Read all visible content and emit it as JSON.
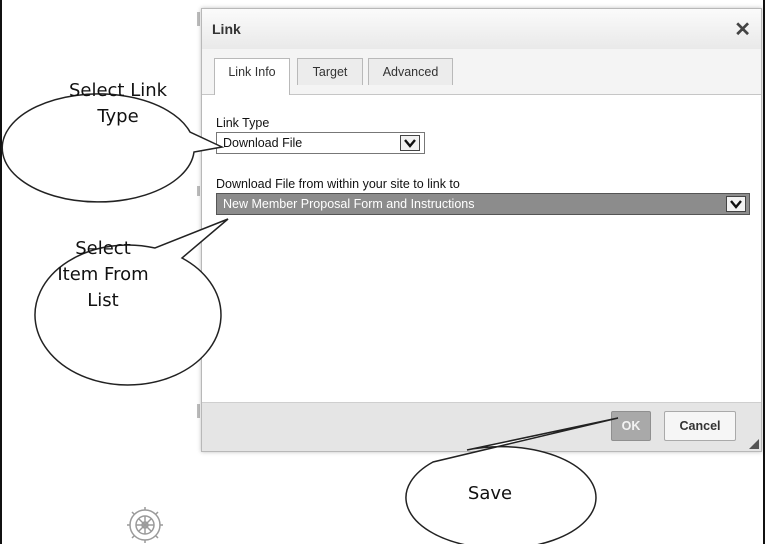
{
  "dialog": {
    "title": "Link",
    "close_icon": "close-icon",
    "tabs": [
      {
        "label": "Link Info",
        "active": true
      },
      {
        "label": "Target",
        "active": false
      },
      {
        "label": "Advanced",
        "active": false
      }
    ],
    "link_type": {
      "label": "Link Type",
      "selected": "Download File"
    },
    "download_file": {
      "label": "Download File from within your site to link to",
      "selected": "New Member Proposal Form and Instructions"
    },
    "buttons": {
      "ok": "OK",
      "cancel": "Cancel"
    }
  },
  "callouts": {
    "link_type": [
      "Select Link",
      "Type"
    ],
    "item": [
      "Select",
      "Item From",
      "List"
    ],
    "save": "Save"
  },
  "colors": {
    "highlight": "#8c8c8c",
    "ok_button": "#a9a9a9",
    "footer": "#e5e5e5"
  }
}
